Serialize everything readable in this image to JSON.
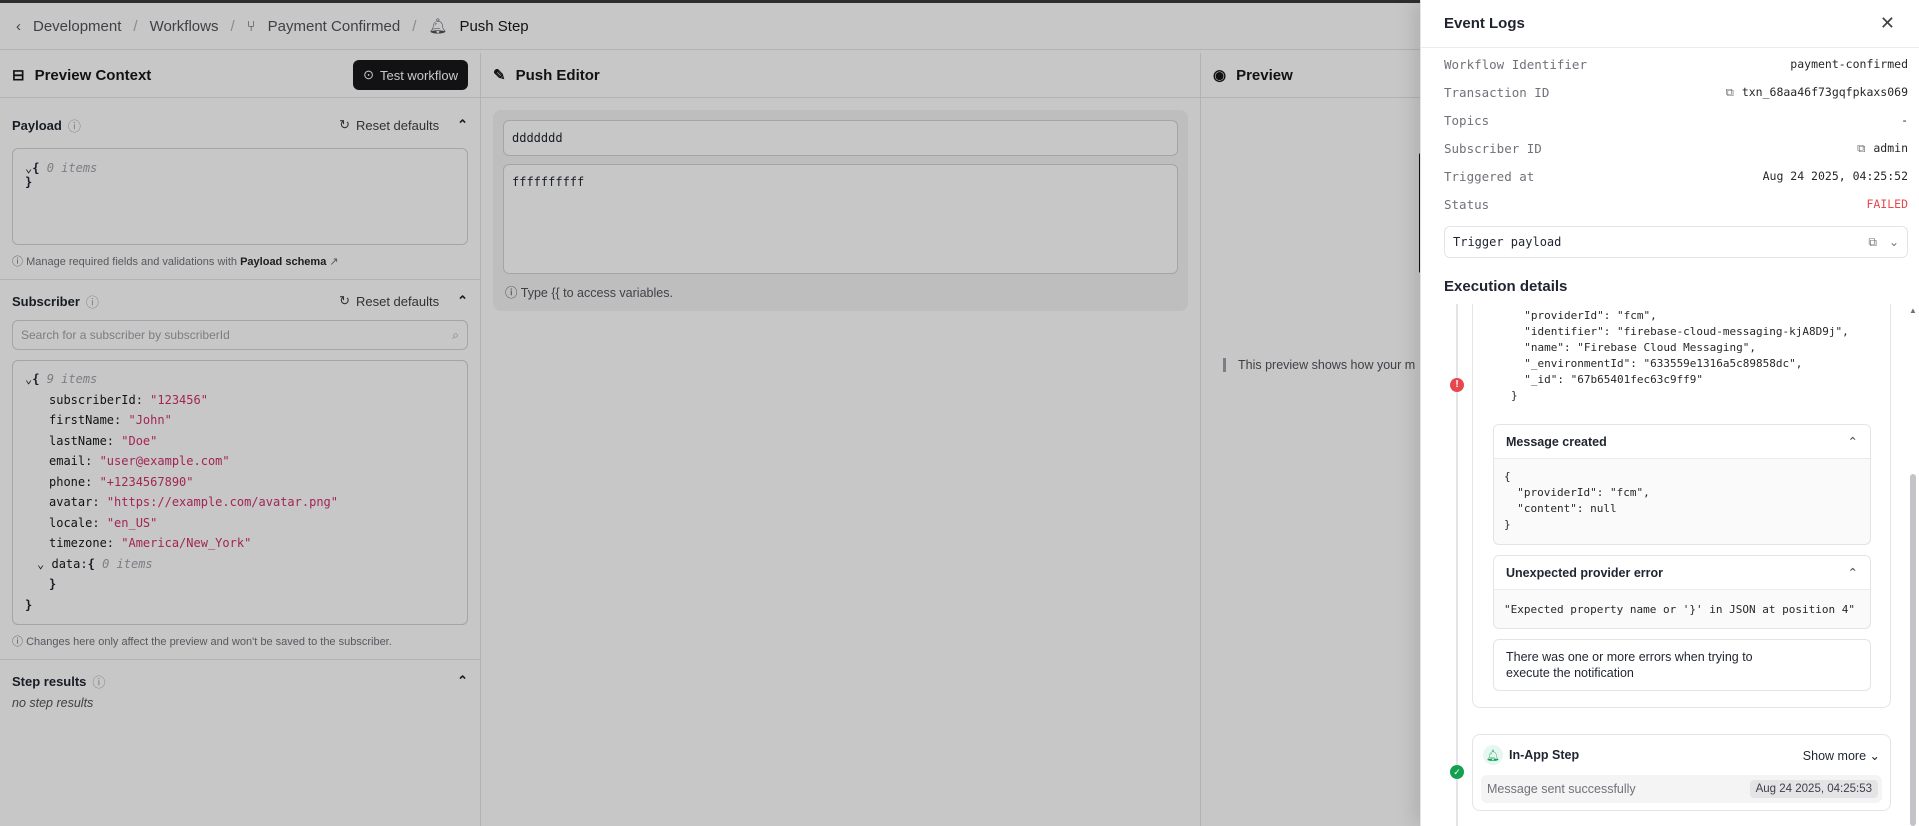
{
  "breadcrumb": [
    "Development",
    "Workflows",
    "Payment Confirmed",
    "Push Step"
  ],
  "preview_context": {
    "title": "Preview Context",
    "test_button": "Test workflow",
    "payload": {
      "label": "Payload",
      "reset": "Reset defaults",
      "json_items": "0 items",
      "hint_prefix": "Manage required fields and validations with",
      "hint_link": "Payload schema"
    },
    "subscriber": {
      "label": "Subscriber",
      "reset": "Reset defaults",
      "search_placeholder": "Search for a subscriber by subscriberId",
      "json_items": "9 items",
      "fields": [
        {
          "k": "subscriberId",
          "v": "\"123456\""
        },
        {
          "k": "firstName",
          "v": "\"John\""
        },
        {
          "k": "lastName",
          "v": "\"Doe\""
        },
        {
          "k": "email",
          "v": "\"user@example.com\""
        },
        {
          "k": "phone",
          "v": "\"+1234567890\""
        },
        {
          "k": "avatar",
          "v": "\"https://example.com/avatar.png\""
        },
        {
          "k": "locale",
          "v": "\"en_US\""
        },
        {
          "k": "timezone",
          "v": "\"America/New_York\""
        }
      ],
      "data_key": "data",
      "data_items": "0 items",
      "hint": "Changes here only affect the preview and won't be saved to the subscriber."
    },
    "step_results": {
      "label": "Step results",
      "empty": "no step results"
    }
  },
  "push_editor": {
    "title": "Push Editor",
    "subject": "ddddddd",
    "body": "ffffffffff",
    "hint": "Type {{ to access variables."
  },
  "preview": {
    "title": "Preview",
    "note": "This preview shows how your m"
  },
  "event_logs": {
    "title": "Event Logs",
    "rows": [
      {
        "k": "Workflow Identifier",
        "v": "payment-confirmed"
      },
      {
        "k": "Transaction ID",
        "v": "txn_68aa46f73gqfpkaxs069"
      },
      {
        "k": "Topics",
        "v": "-"
      },
      {
        "k": "Subscriber ID",
        "v": "admin"
      },
      {
        "k": "Triggered at",
        "v": "Aug 24 2025, 04:25:52"
      },
      {
        "k": "Status",
        "v": "FAILED"
      }
    ],
    "trigger_payload": "Trigger payload",
    "execution_title": "Execution details",
    "top_code": "  \"providerId\": \"fcm\",\n  \"identifier\": \"firebase-cloud-messaging-kjA8D9j\",\n  \"name\": \"Firebase Cloud Messaging\",\n  \"_environmentId\": \"633559e1316a5c89858dc\",\n  \"_id\": \"67b65401fec63c9ff9\"\n}",
    "message_created": {
      "title": "Message created",
      "body": "{\n  \"providerId\": \"fcm\",\n  \"content\": null\n}"
    },
    "provider_error": {
      "title": "Unexpected provider error",
      "body": "\"Expected property name or '}' in JSON at position 4\""
    },
    "error_summary": "There was one or more errors when trying to\nexecute the notification",
    "inapp": {
      "title": "In-App Step",
      "show_more": "Show more",
      "message": "Message sent successfully",
      "time": "Aug 24 2025, 04:25:53"
    }
  }
}
